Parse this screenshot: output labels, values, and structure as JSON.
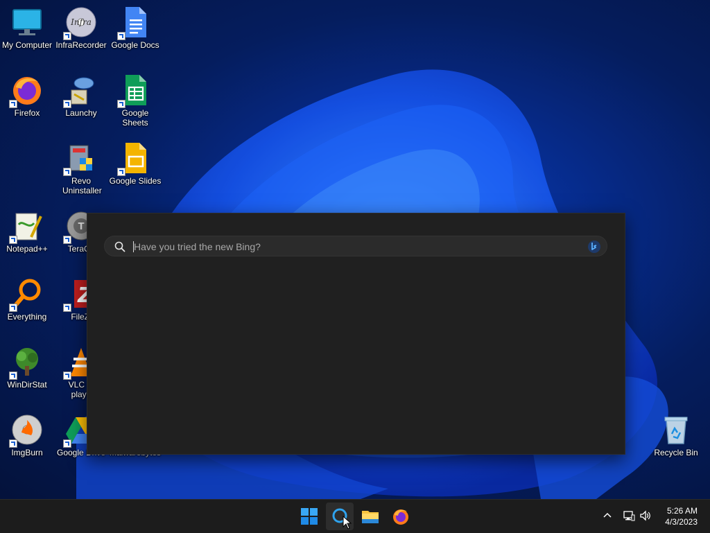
{
  "desktop": {
    "icons": [
      {
        "label": "My Computer",
        "icon": "monitor-icon"
      },
      {
        "label": "InfraRecorder",
        "icon": "infrarecorder-icon"
      },
      {
        "label": "Google Docs",
        "icon": "google-docs-icon"
      },
      {
        "label": "Firefox",
        "icon": "firefox-icon"
      },
      {
        "label": "Launchy",
        "icon": "launchy-icon"
      },
      {
        "label": "Google Sheets",
        "icon": "google-sheets-icon"
      },
      {
        "label": "Revo Uninstaller",
        "icon": "revo-uninstaller-icon"
      },
      {
        "label": "Google Slides",
        "icon": "google-slides-icon"
      },
      {
        "label": "Notepad++",
        "icon": "notepadpp-icon"
      },
      {
        "label": "TeraCo",
        "icon": "teracopy-icon"
      },
      {
        "label": "Everything",
        "icon": "everything-search-icon"
      },
      {
        "label": "FileZi",
        "icon": "filezilla-icon"
      },
      {
        "label": "WinDirStat",
        "icon": "windirstat-icon"
      },
      {
        "label": "VLC m\nplaye",
        "icon": "vlc-icon"
      },
      {
        "label": "ImgBurn",
        "icon": "imgburn-icon"
      },
      {
        "label": "Google Drive",
        "icon": "google-drive-icon"
      },
      {
        "label": "Malwarebytes",
        "icon": "malwarebytes-icon"
      },
      {
        "label": "Recycle Bin",
        "icon": "recycle-bin-icon"
      }
    ]
  },
  "search": {
    "placeholder": "Have you tried the new Bing?",
    "value": "",
    "icons": {
      "search": "search-icon",
      "bing": "bing-chat-icon"
    }
  },
  "taskbar": {
    "apps": [
      {
        "name": "Start",
        "icon": "windows-start-icon"
      },
      {
        "name": "Search",
        "icon": "search-icon",
        "active": true
      },
      {
        "name": "File Explorer",
        "icon": "file-explorer-icon"
      },
      {
        "name": "Firefox",
        "icon": "firefox-icon"
      }
    ],
    "tray": {
      "icons": [
        "chevron-up-icon",
        "network-icon",
        "volume-icon"
      ]
    },
    "clock": {
      "time": "5:26 AM",
      "date": "4/3/2023"
    }
  },
  "colors": {
    "accent": "#0a5fd6",
    "panel": "#202020",
    "taskbar": "#1c1c1c"
  }
}
